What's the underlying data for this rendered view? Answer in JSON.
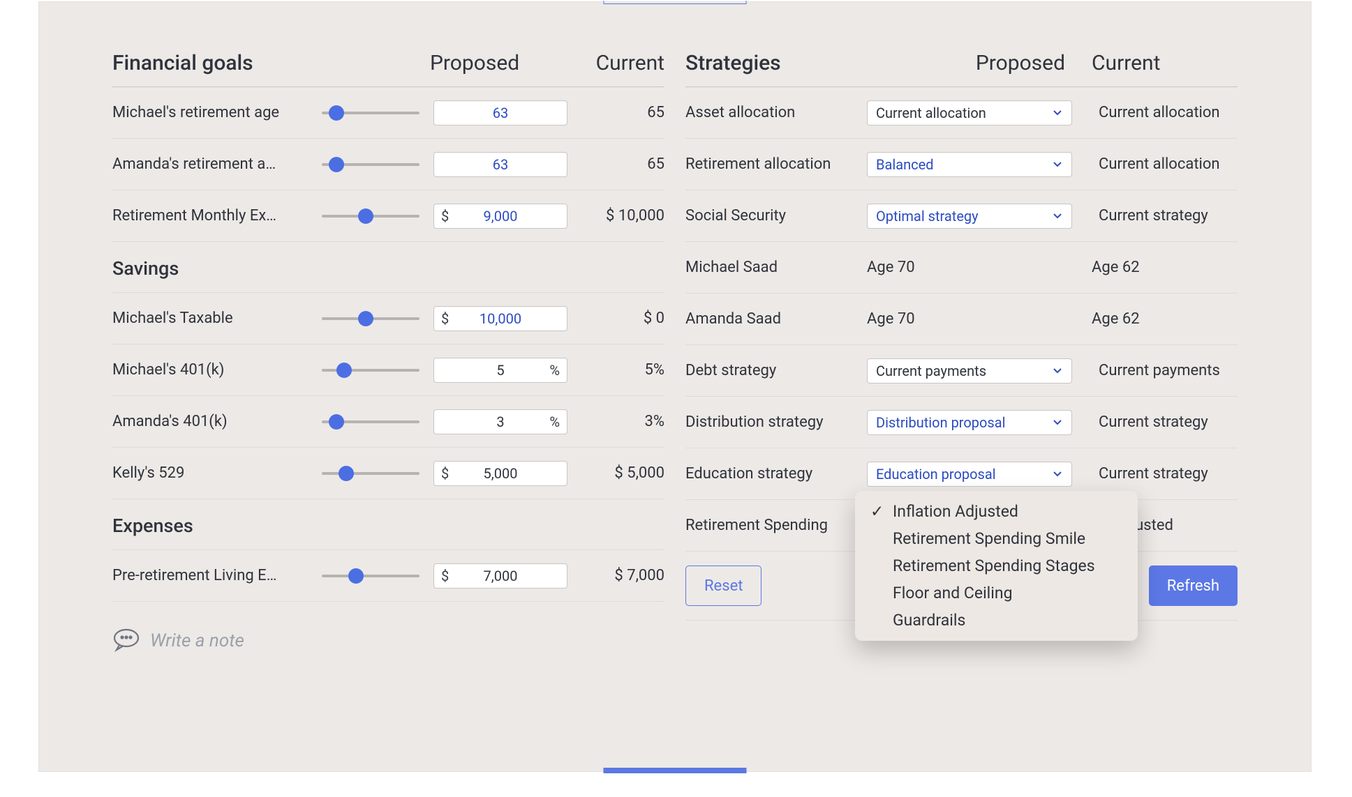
{
  "headers": {
    "goals": "Financial goals",
    "proposed": "Proposed",
    "current": "Current",
    "strategies": "Strategies",
    "savings": "Savings",
    "expenses": "Expenses"
  },
  "goals": [
    {
      "label": "Michael's retirement age",
      "value": "63",
      "current": "65",
      "prefix": "",
      "suffix": "",
      "slider": 15,
      "changed": true
    },
    {
      "label": "Amanda's retirement a…",
      "value": "63",
      "current": "65",
      "prefix": "",
      "suffix": "",
      "slider": 15,
      "changed": true
    },
    {
      "label": "Retirement Monthly Ex…",
      "value": "9,000",
      "current": "$ 10,000",
      "prefix": "$",
      "suffix": "",
      "slider": 45,
      "changed": true
    }
  ],
  "savings": [
    {
      "label": "Michael's Taxable",
      "value": "10,000",
      "current": "$ 0",
      "prefix": "$",
      "suffix": "",
      "slider": 45,
      "changed": true
    },
    {
      "label": "Michael's 401(k)",
      "value": "5",
      "current": "5%",
      "prefix": "",
      "suffix": "%",
      "slider": 23,
      "changed": false
    },
    {
      "label": "Amanda's 401(k)",
      "value": "3",
      "current": "3%",
      "prefix": "",
      "suffix": "%",
      "slider": 15,
      "changed": false
    },
    {
      "label": "Kelly's 529",
      "value": "5,000",
      "current": "$ 5,000",
      "prefix": "$",
      "suffix": "",
      "slider": 25,
      "changed": false
    }
  ],
  "expenses": [
    {
      "label": "Pre-retirement Living E…",
      "value": "7,000",
      "current": "$ 7,000",
      "prefix": "$",
      "suffix": "",
      "slider": 35,
      "changed": false
    }
  ],
  "strategies": [
    {
      "label": "Asset allocation",
      "value": "Current allocation",
      "current": "Current allocation",
      "changed": false,
      "type": "select"
    },
    {
      "label": "Retirement allocation",
      "value": "Balanced",
      "current": "Current allocation",
      "changed": true,
      "type": "select"
    },
    {
      "label": "Social Security",
      "value": "Optimal strategy",
      "current": "Current strategy",
      "changed": true,
      "type": "select"
    },
    {
      "label": "Michael Saad",
      "value": "Age 70",
      "current": "Age 62",
      "type": "text"
    },
    {
      "label": "Amanda Saad",
      "value": "Age 70",
      "current": "Age 62",
      "type": "text"
    },
    {
      "label": "Debt strategy",
      "value": "Current payments",
      "current": "Current payments",
      "changed": false,
      "type": "select"
    },
    {
      "label": "Distribution strategy",
      "value": "Distribution proposal",
      "current": "Current strategy",
      "changed": true,
      "type": "select"
    },
    {
      "label": "Education strategy",
      "value": "Education proposal",
      "current": "Current strategy",
      "changed": true,
      "type": "select"
    },
    {
      "label": "Retirement Spending",
      "value": "",
      "current": "on Adjusted",
      "type": "select-open"
    }
  ],
  "dropdown": {
    "items": [
      {
        "label": "Inflation Adjusted",
        "selected": true
      },
      {
        "label": "Retirement Spending Smile",
        "selected": false
      },
      {
        "label": "Retirement Spending Stages",
        "selected": false
      },
      {
        "label": "Floor and Ceiling",
        "selected": false
      },
      {
        "label": "Guardrails",
        "selected": false
      }
    ]
  },
  "buttons": {
    "reset": "Reset",
    "revert": "",
    "refresh": "Refresh"
  },
  "note": {
    "placeholder": "Write a note"
  }
}
